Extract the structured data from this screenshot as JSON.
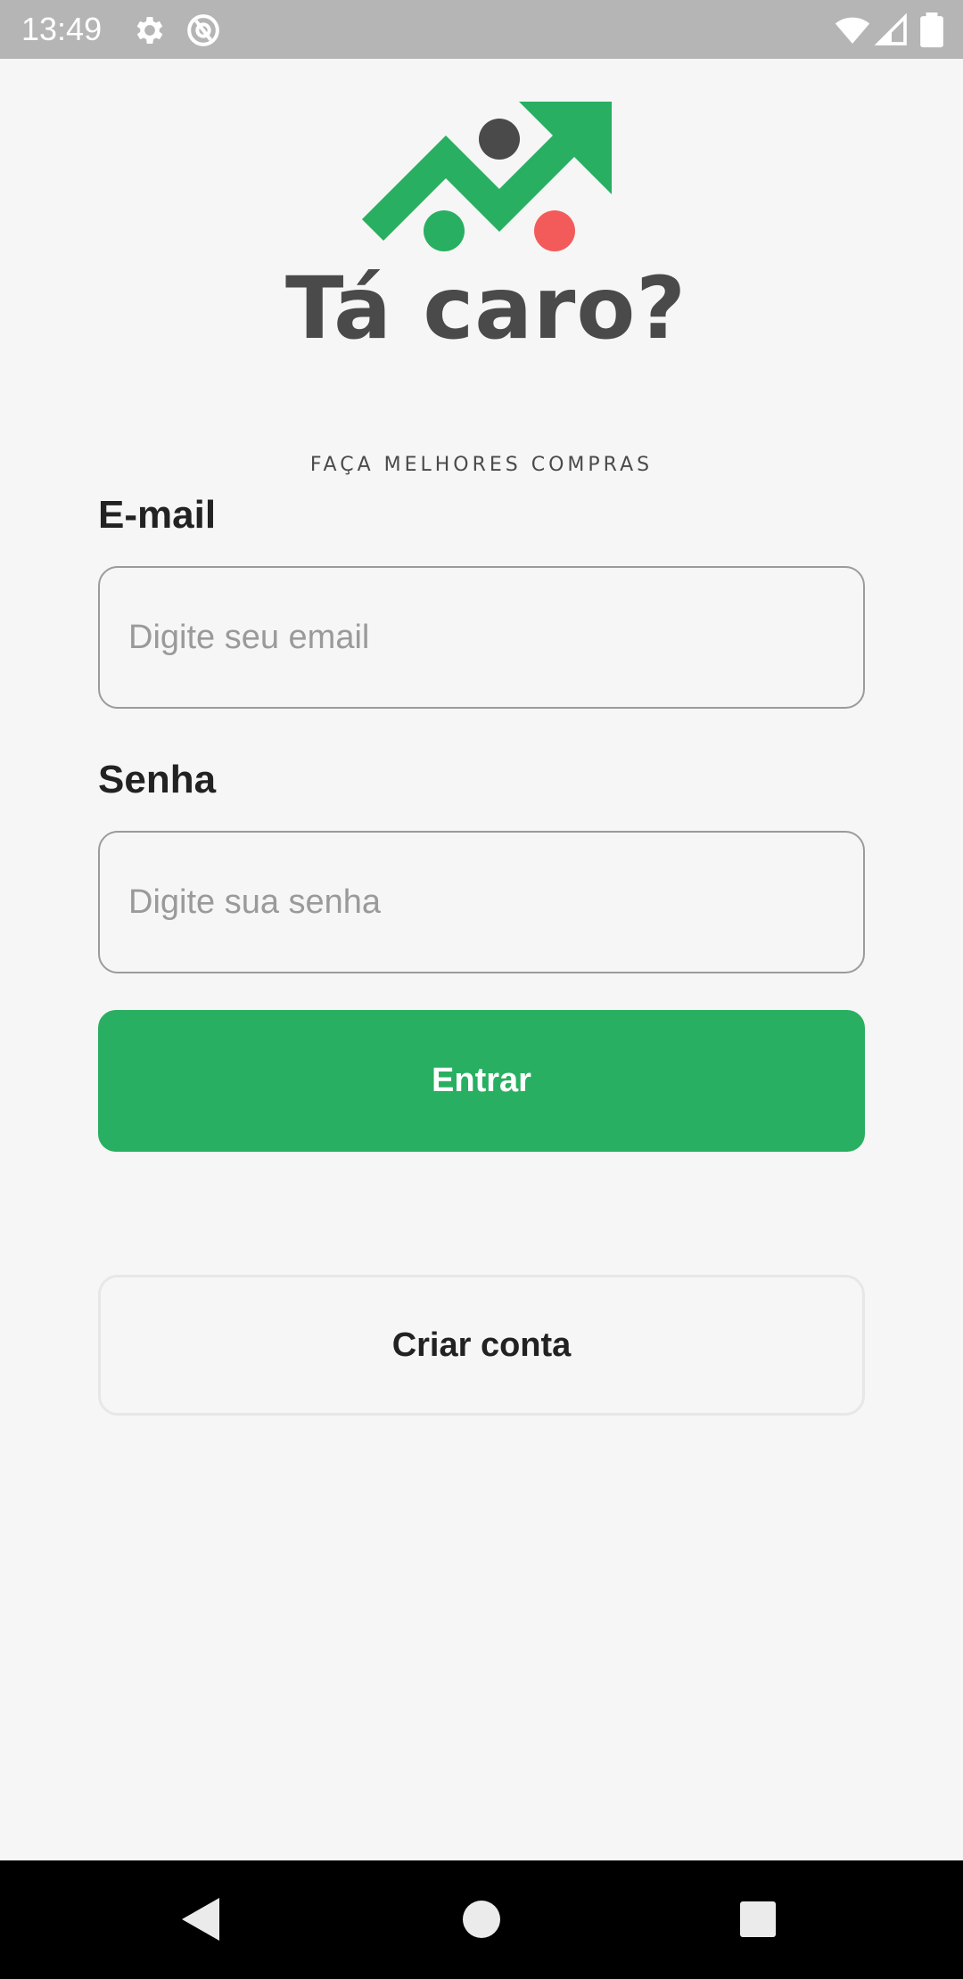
{
  "status_bar": {
    "time": "13:49",
    "icons": [
      "gear-icon",
      "at-sign-icon",
      "wifi-icon",
      "signal-icon",
      "battery-icon"
    ],
    "text_color": "#ffffff",
    "background": "#b5b5b5"
  },
  "logo": {
    "title": "Tá caro?",
    "tagline": "FAÇA MELHORES COMPRAS",
    "colors": {
      "arrow": "#29af61",
      "dot_dark": "#4a4a4a",
      "dot_green": "#29af61",
      "dot_red": "#f35b5b"
    }
  },
  "form": {
    "email_label": "E-mail",
    "email_placeholder": "Digite seu email",
    "password_label": "Senha",
    "password_placeholder": "Digite sua senha",
    "submit_label": "Entrar",
    "create_account_label": "Criar conta"
  },
  "theme": {
    "primary": "#29af61",
    "background": "#f6f6f6",
    "text": "#222222"
  },
  "nav_bar": {
    "icons": [
      "back-icon",
      "home-icon",
      "recents-icon"
    ]
  }
}
